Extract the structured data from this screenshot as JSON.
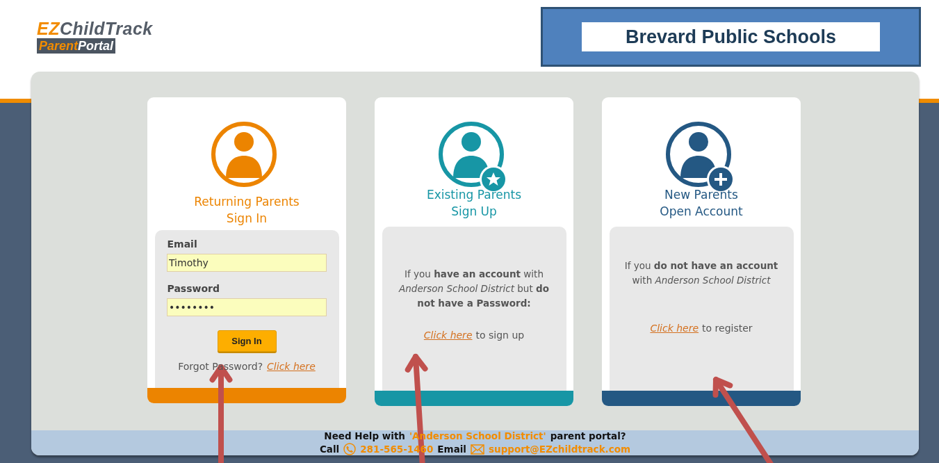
{
  "logo": {
    "brand_highlight": "EZ",
    "brand_rest": "ChildTrack",
    "sub_highlight": "Parent",
    "sub_rest": "Portal"
  },
  "district_banner": "Brevard Public Schools",
  "cards": [
    {
      "kind": "login",
      "color": "#ec8400",
      "title": [
        "Returning Parents",
        "Sign In"
      ],
      "email_label": "Email",
      "email_value": "Timothy",
      "password_label": "Password",
      "password_value": "••••••••",
      "button": "Sign In",
      "forgot_text": "Forgot Password?",
      "forgot_link": "Click here"
    },
    {
      "kind": "signup",
      "color": "#1796a5",
      "title": [
        "Existing Parents",
        "Sign Up"
      ],
      "body": "If you **have an account** with *Anderson School District* but **do not have a Password:**",
      "link": "Click here",
      "link_after": "to sign up"
    },
    {
      "kind": "register",
      "color": "#245883",
      "title": [
        "New Parents",
        "Open Account"
      ],
      "body": "If you **do not have an account** with *Anderson School District*",
      "link": "Click here",
      "link_after": "to register"
    }
  ],
  "help": {
    "line_start": "Need Help with",
    "district": "'Anderson School District'",
    "line_end": "parent portal?",
    "call_label": "Call",
    "phone": "281-565-1460",
    "email_label": "Email",
    "email": "support@EZchildtrack.com"
  }
}
